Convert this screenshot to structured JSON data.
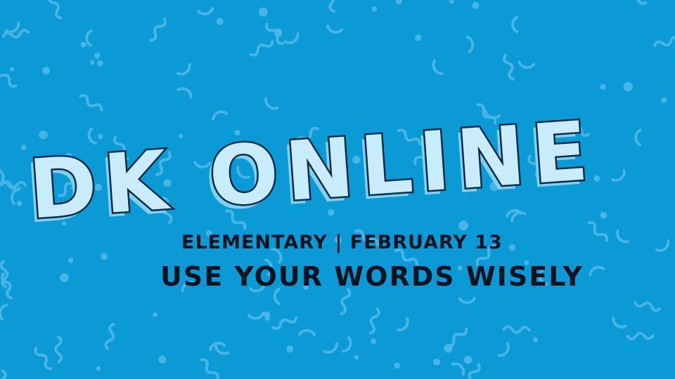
{
  "slide": {
    "title": "DK ONLINE",
    "subtitle": "ELEMENTARY | FEBRUARY 13",
    "tagline": "USE YOUR WORDS WISELY"
  },
  "colors": {
    "background": "#0a9bd6",
    "pattern": "#46b6e6",
    "title_fill": "#c8ecfb",
    "title_outline": "#0d2a44",
    "title_shadow": "#7fd0f2",
    "text_dark": "#0d1420"
  }
}
